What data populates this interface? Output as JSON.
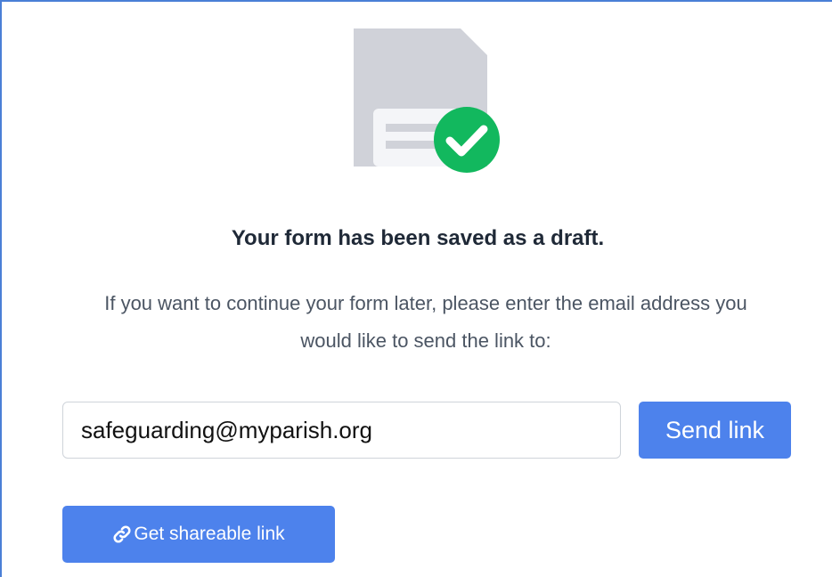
{
  "illustration": {
    "icon": "floppy-disk-saved-icon",
    "disk_color": "#d0d2d9",
    "check_color": "#12b85e"
  },
  "message": {
    "title": "Your form has been saved as a draft.",
    "body": "If you want to continue your form later, please enter the email address you would like to send the link to:"
  },
  "email": {
    "value": "safeguarding@myparish.org"
  },
  "actions": {
    "send_label": "Send link",
    "share_label": "Get shareable link",
    "share_icon": "link-icon",
    "button_color": "#4d82ec"
  }
}
